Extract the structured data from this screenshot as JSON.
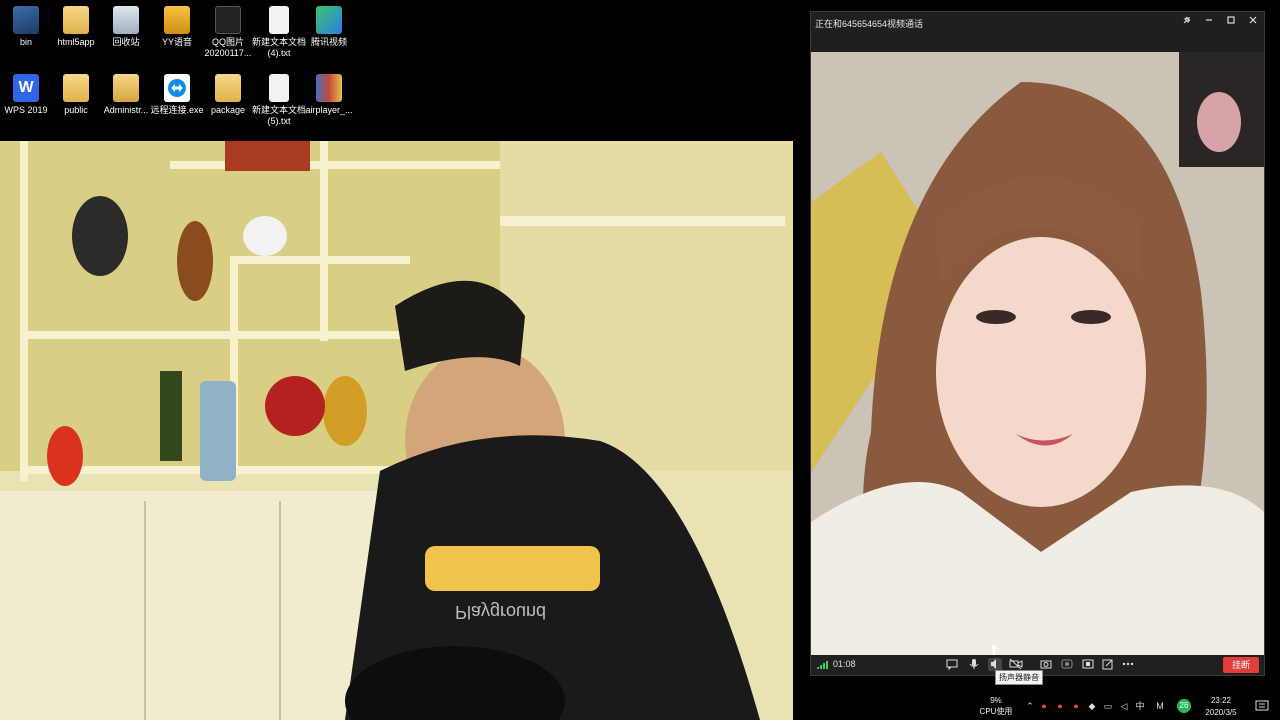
{
  "desktop": {
    "icons": [
      {
        "label": "bin",
        "icon": "app-icon"
      },
      {
        "label": "html5app",
        "icon": "folder-icon"
      },
      {
        "label": "回收站",
        "icon": "recycle-bin-icon"
      },
      {
        "label": "YY语音",
        "icon": "yy-voice-icon"
      },
      {
        "label": "QQ图片\n20200117...",
        "icon": "image-file-icon"
      },
      {
        "label": "新建文本文档\n(4).txt",
        "icon": "text-file-icon"
      },
      {
        "label": "腾讯视频",
        "icon": "tencent-video-icon"
      },
      {
        "label": "WPS 2019",
        "icon": "wps-icon"
      },
      {
        "label": "public",
        "icon": "folder-icon"
      },
      {
        "label": "Administr...",
        "icon": "user-folder-icon"
      },
      {
        "label": "远程连接.exe",
        "icon": "teamviewer-icon"
      },
      {
        "label": "package",
        "icon": "folder-icon"
      },
      {
        "label": "新建文本文档\n(5).txt",
        "icon": "text-file-icon"
      },
      {
        "label": "airplayer_...",
        "icon": "archive-icon"
      }
    ]
  },
  "call": {
    "title": "正在和645654654视频通话",
    "timer": "01:08",
    "hangup_label": "挂断",
    "tooltip": "扬声器静音",
    "volume_level": 1.0,
    "toolbar_icons": [
      "chat-icon",
      "microphone-icon",
      "speaker-icon",
      "camera-off-icon",
      "screenshot-icon",
      "record-icon",
      "screen-share-icon",
      "edit-icon",
      "more-icon"
    ],
    "window_controls": [
      "pin-icon",
      "minimize-icon",
      "maximize-icon",
      "close-icon"
    ]
  },
  "tray": {
    "cpu_percent": "9%",
    "cpu_label": "CPU使用",
    "ime_label": "中",
    "badge": "26",
    "time": "23:22",
    "date": "2020/3/5",
    "colors": {
      "hangup": "#e23c3c",
      "badge": "#27b561",
      "signal": "#3ccf4e"
    }
  }
}
